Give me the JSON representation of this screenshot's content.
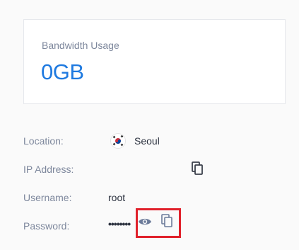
{
  "bandwidth": {
    "title": "Bandwidth Usage",
    "value": "0GB"
  },
  "details": {
    "location": {
      "label": "Location:",
      "value": "Seoul",
      "flag_icon": "south-korea-flag-icon"
    },
    "ip": {
      "label": "IP Address:",
      "value": "",
      "copy_icon": "copy-icon"
    },
    "username": {
      "label": "Username:",
      "value": "root"
    },
    "password": {
      "label": "Password:",
      "masked_value": "••••••••",
      "reveal_icon": "eye-icon",
      "copy_icon": "copy-icon"
    }
  },
  "colors": {
    "accent": "#1f7ae0",
    "label": "#7d879c",
    "highlight": "#e0212b"
  }
}
